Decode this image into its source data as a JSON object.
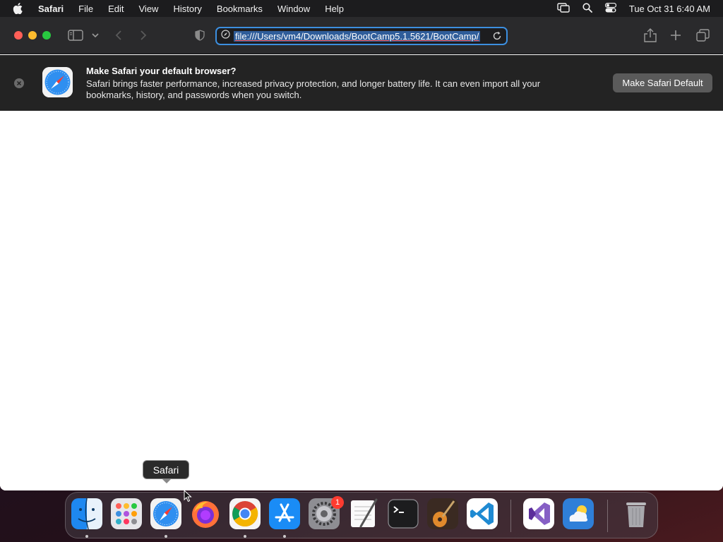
{
  "menubar": {
    "app_name": "Safari",
    "items": [
      "File",
      "Edit",
      "View",
      "History",
      "Bookmarks",
      "Window",
      "Help"
    ],
    "clock": "Tue Oct 31  6:40 AM"
  },
  "toolbar": {
    "url": "file:///Users/vm4/Downloads/BootCamp5.1.5621/BootCamp/"
  },
  "banner": {
    "title": "Make Safari your default browser?",
    "body": "Safari brings faster performance, increased privacy protection, and longer battery life. It can even import all your bookmarks, history, and passwords when you switch.",
    "button_label": "Make Safari Default"
  },
  "dock": {
    "tooltip": "Safari",
    "apps": [
      "Finder",
      "Launchpad",
      "Safari",
      "Firefox",
      "Google Chrome",
      "App Store",
      "System Settings",
      "TextEdit",
      "Terminal",
      "GarageBand",
      "Visual Studio Code",
      "Visual Studio",
      "Weather",
      "Trash"
    ],
    "settings_badge": "1"
  },
  "colors": {
    "accent": "#3c8fe0",
    "close": "#ff5f57",
    "minimize": "#febc2e",
    "maximize": "#28c840",
    "badge": "#ff3b30"
  }
}
